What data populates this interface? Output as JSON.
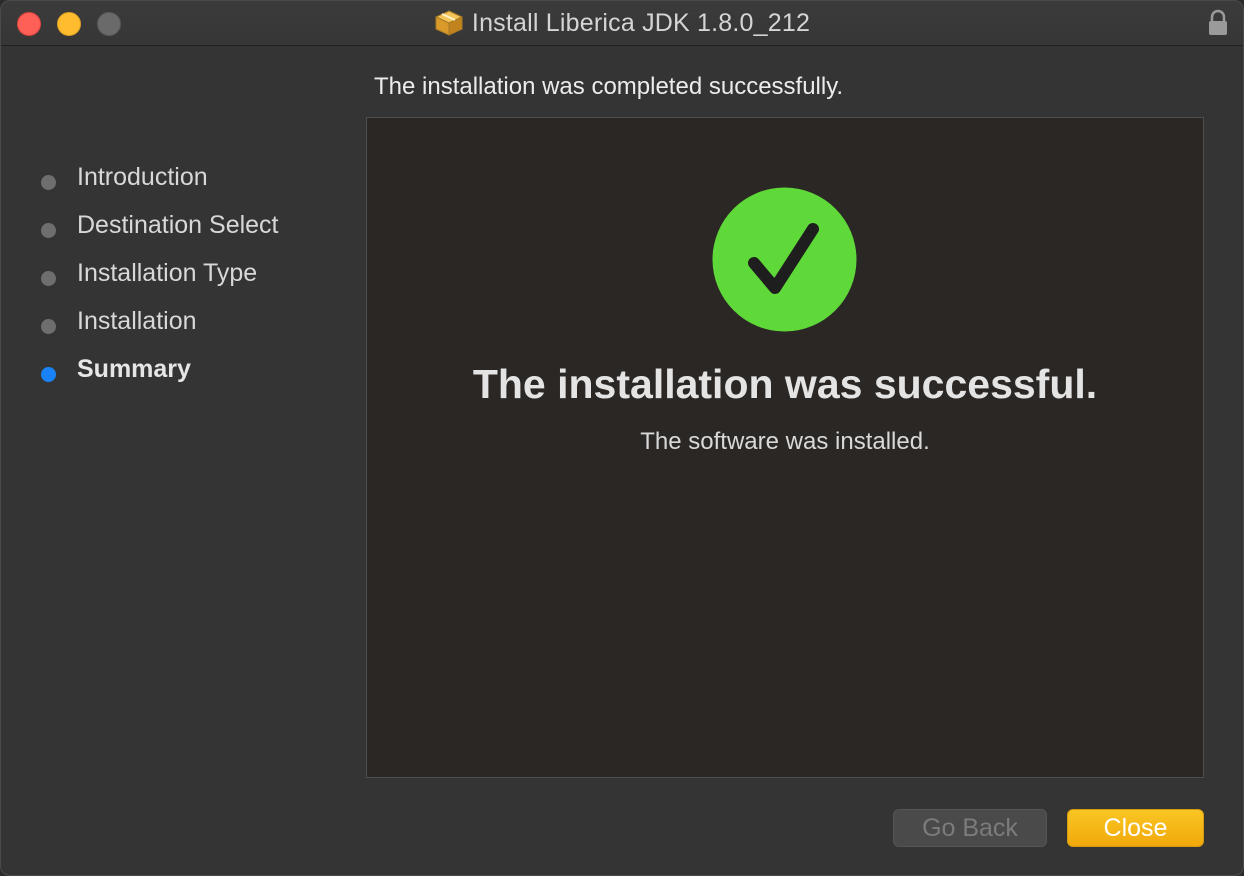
{
  "window": {
    "title": "Install Liberica JDK 1.8.0_212",
    "title_icon": "package-icon",
    "lock_icon": "lock-icon"
  },
  "header": {
    "text": "The installation was completed successfully."
  },
  "sidebar": {
    "steps": [
      {
        "label": "Introduction",
        "active": false
      },
      {
        "label": "Destination Select",
        "active": false
      },
      {
        "label": "Installation Type",
        "active": false
      },
      {
        "label": "Installation",
        "active": false
      },
      {
        "label": "Summary",
        "active": true
      }
    ]
  },
  "main": {
    "status_icon": "checkmark-circle-icon",
    "title": "The installation was successful.",
    "subtitle": "The software was installed."
  },
  "buttons": {
    "back_label": "Go Back",
    "back_enabled": false,
    "close_label": "Close"
  },
  "colors": {
    "accent_blue": "#1a82f7",
    "success_green": "#5fd939",
    "close_button": "#f5b616"
  }
}
